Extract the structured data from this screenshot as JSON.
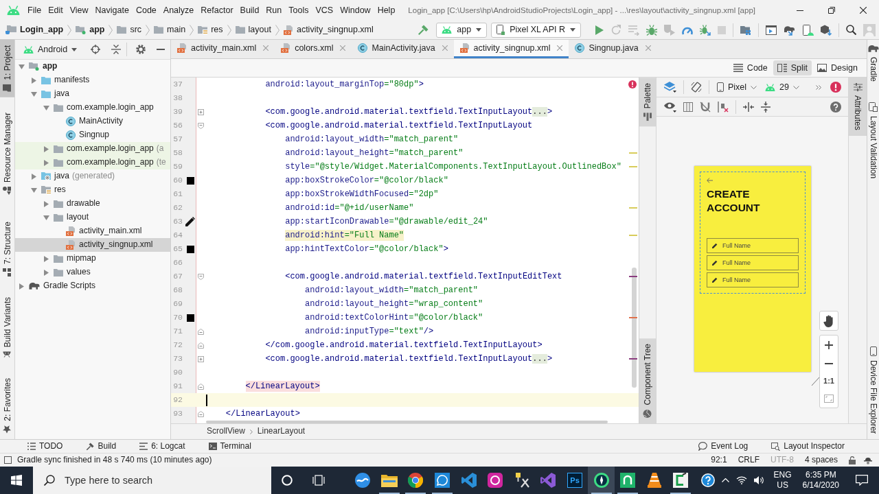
{
  "window": {
    "title": "Login_app [C:\\Users\\hp\\AndroidStudioProjects\\Login_app] - ...\\res\\layout\\activity_singnup.xml [app]"
  },
  "menu": [
    "File",
    "Edit",
    "View",
    "Navigate",
    "Code",
    "Analyze",
    "Refactor",
    "Build",
    "Run",
    "Tools",
    "VCS",
    "Window",
    "Help"
  ],
  "breadcrumbs": [
    {
      "label": "Login_app",
      "kind": "project"
    },
    {
      "label": "app",
      "kind": "module"
    },
    {
      "label": "src",
      "kind": "folder"
    },
    {
      "label": "main",
      "kind": "folder"
    },
    {
      "label": "res",
      "kind": "res"
    },
    {
      "label": "layout",
      "kind": "folder"
    },
    {
      "label": "activity_singnup.xml",
      "kind": "xml"
    }
  ],
  "toolbar": {
    "run_configuration": "app",
    "device": "Pixel XL API R",
    "action_groups": [
      [
        {
          "kind": "build",
          "disabled": false
        }
      ],
      [
        {
          "kind": "run",
          "disabled": false
        },
        {
          "kind": "apply-restart",
          "disabled": true
        },
        {
          "kind": "apply-code",
          "disabled": true
        },
        {
          "kind": "debug",
          "disabled": false
        },
        {
          "kind": "coverage",
          "disabled": true
        },
        {
          "kind": "profile",
          "disabled": false
        },
        {
          "kind": "attach",
          "disabled": false
        },
        {
          "kind": "stop",
          "disabled": true
        }
      ],
      [
        {
          "kind": "structure",
          "disabled": false
        }
      ],
      [
        {
          "kind": "window",
          "disabled": false
        },
        {
          "kind": "sync",
          "disabled": false
        },
        {
          "kind": "avd",
          "disabled": false
        },
        {
          "kind": "sdk",
          "disabled": false
        }
      ],
      [
        {
          "kind": "search",
          "disabled": false
        },
        {
          "kind": "account",
          "disabled": false
        }
      ]
    ]
  },
  "left_tool_strip": {
    "top": [
      {
        "label": "1: Project",
        "kind": "project",
        "selected": true
      },
      {
        "label": "Resource Manager",
        "kind": "resources",
        "selected": false
      }
    ],
    "bottom": [
      {
        "label": "7: Structure",
        "kind": "structure",
        "selected": false
      },
      {
        "label": "Build Variants",
        "kind": "variants",
        "selected": false
      },
      {
        "label": "2: Favorites",
        "kind": "favorites",
        "selected": false
      }
    ]
  },
  "project_view": {
    "mode": "Android",
    "tree": [
      {
        "label": "app",
        "kind": "module",
        "expanded": true,
        "selected": false,
        "children": [
          {
            "label": "manifests",
            "kind": "source",
            "expanded": false,
            "selected": false
          },
          {
            "label": "java",
            "kind": "source",
            "expanded": true,
            "selected": false,
            "children": [
              {
                "label": "com.example.login_app",
                "kind": "folder",
                "expanded": true,
                "selected": false,
                "children": [
                  {
                    "label": "MainActivity",
                    "kind": "class",
                    "selected": false
                  },
                  {
                    "label": "Singnup",
                    "kind": "class",
                    "selected": false
                  }
                ]
              },
              {
                "label": "com.example.login_app",
                "note": "(a",
                "kind": "test-package",
                "expanded": false,
                "selected": false
              },
              {
                "label": "com.example.login_app",
                "note": "(te",
                "kind": "test-package",
                "expanded": false,
                "selected": false
              }
            ]
          },
          {
            "label": "java",
            "note": "(generated)",
            "kind": "generated",
            "expanded": false,
            "selected": false
          },
          {
            "label": "res",
            "kind": "res",
            "expanded": true,
            "selected": false,
            "children": [
              {
                "label": "drawable",
                "kind": "folder",
                "expanded": false,
                "selected": false
              },
              {
                "label": "layout",
                "kind": "folder",
                "expanded": true,
                "selected": false,
                "children": [
                  {
                    "label": "activity_main.xml",
                    "kind": "xml",
                    "selected": false
                  },
                  {
                    "label": "activity_singnup.xml",
                    "kind": "xml",
                    "selected": true
                  }
                ]
              },
              {
                "label": "mipmap",
                "kind": "folder",
                "expanded": false,
                "selected": false
              },
              {
                "label": "values",
                "kind": "folder",
                "expanded": false,
                "selected": false
              }
            ]
          }
        ]
      },
      {
        "label": "Gradle Scripts",
        "kind": "gradle",
        "expanded": false,
        "selected": false
      }
    ]
  },
  "editor_tabs": [
    {
      "label": "activity_main.xml",
      "kind": "xml",
      "selected": false
    },
    {
      "label": "colors.xml",
      "kind": "xml",
      "selected": false
    },
    {
      "label": "MainActivity.java",
      "kind": "class",
      "selected": false
    },
    {
      "label": "activity_singnup.xml",
      "kind": "xml",
      "selected": true
    },
    {
      "label": "Singnup.java",
      "kind": "class",
      "selected": false
    }
  ],
  "view_modes": [
    {
      "label": "Code",
      "selected": false
    },
    {
      "label": "Split",
      "selected": true
    },
    {
      "label": "Design",
      "selected": false
    }
  ],
  "code": {
    "lines": [
      {
        "n": "37",
        "text": "            android:layout_marginTop=\"80dp\">"
      },
      {
        "n": "38"
      },
      {
        "n": "39",
        "text": "            <com.google.android.material.textfield.TextInputLayout",
        "fold": {
          "kind": "collapsed"
        },
        "folded": "...",
        "tail": ">"
      },
      {
        "n": "56",
        "text": "            <com.google.android.material.textfield.TextInputLayout",
        "fold": {
          "kind": "start"
        }
      },
      {
        "n": "57",
        "text": "                android:layout_width=\"match_parent\""
      },
      {
        "n": "58",
        "text": "                android:layout_height=\"match_parent\"",
        "stripe": {
          "kind": "warning"
        }
      },
      {
        "n": "59",
        "text": "                style=\"@style/Widget.MaterialComponents.TextInputLayout.OutlinedBox\"",
        "stripe": {
          "kind": "warning"
        }
      },
      {
        "n": "60",
        "text": "                app:boxStrokeColor=\"@color/black\"",
        "gutter": {
          "kind": "swatch",
          "color": "#000000"
        }
      },
      {
        "n": "61",
        "text": "                app:boxStrokeWidthFocused=\"2dp\""
      },
      {
        "n": "62",
        "text": "                android:id=\"@+id/userName\"",
        "stripe": {
          "kind": "warning"
        }
      },
      {
        "n": "63",
        "text": "                app:startIconDrawable=\"@drawable/edit_24\"",
        "gutter": {
          "kind": "drawable"
        }
      },
      {
        "n": "64",
        "text": "                android:hint=\"Full Name\"",
        "highlight": {
          "kind": "text"
        },
        "stripe": {
          "kind": "warning"
        }
      },
      {
        "n": "65",
        "text": "                app:hintTextColor=\"@color/black\">",
        "gutter": {
          "kind": "swatch",
          "color": "#000000"
        }
      },
      {
        "n": "66"
      },
      {
        "n": "67",
        "text": "                <com.google.android.material.textfield.TextInputEditText",
        "fold": {
          "kind": "start"
        },
        "stripe": {
          "kind": "info"
        }
      },
      {
        "n": "68",
        "text": "                    android:layout_width=\"match_parent\""
      },
      {
        "n": "69",
        "text": "                    android:layout_height=\"wrap_content\""
      },
      {
        "n": "70",
        "text": "                    android:textColorHint=\"@color/black\"",
        "gutter": {
          "kind": "swatch",
          "color": "#000000"
        },
        "stripe": {
          "kind": "error"
        }
      },
      {
        "n": "71",
        "text": "                    android:inputType=\"text\"/>",
        "fold": {
          "kind": "end"
        }
      },
      {
        "n": "72",
        "text": "            </com.google.android.material.textfield.TextInputLayout>",
        "fold": {
          "kind": "end"
        }
      },
      {
        "n": "73",
        "text": "            <com.google.android.material.textfield.TextInputLayout",
        "fold": {
          "kind": "collapsed"
        },
        "folded": "...",
        "tail": ">",
        "stripe": {
          "kind": "info"
        }
      },
      {
        "n": "90"
      },
      {
        "n": "91",
        "text": "        </LinearLayout>",
        "fold": {
          "kind": "end"
        },
        "highlight": {
          "kind": "tag"
        }
      },
      {
        "n": "92",
        "highlight": {
          "kind": "caret"
        }
      },
      {
        "n": "93",
        "text": "    </LinearLayout>",
        "fold": {
          "kind": "end"
        }
      }
    ]
  },
  "editor_breadcrumbs": [
    "ScrollView",
    "LinearLayout"
  ],
  "design": {
    "left_tabs": {
      "top": [
        {
          "label": "Palette",
          "kind": "palette"
        }
      ],
      "bottom": [
        {
          "label": "Component Tree",
          "kind": "tree"
        }
      ]
    },
    "right_tabs": [
      {
        "label": "Attributes",
        "kind": "attributes"
      }
    ],
    "device": "Pixel",
    "api_level": "29",
    "zoom_label": "1:1",
    "preview": {
      "title": "CREATE ACCOUNT",
      "fields": [
        {
          "placeholder": "Full Name"
        },
        {
          "placeholder": "Full Name"
        },
        {
          "placeholder": "Full Name"
        }
      ]
    }
  },
  "right_tool_strip": {
    "top": [
      {
        "label": "Gradle",
        "kind": "gradle"
      },
      {
        "label": "Layout Validation",
        "kind": "validation"
      }
    ],
    "bottom": [
      {
        "label": "Device File Explorer",
        "kind": "device"
      }
    ]
  },
  "bottom_tool_windows": {
    "left": [
      {
        "label": "TODO",
        "kind": "todo"
      },
      {
        "label": "Build",
        "kind": "build"
      },
      {
        "label": "6: Logcat",
        "kind": "logcat"
      },
      {
        "label": "Terminal",
        "kind": "terminal"
      }
    ],
    "right": [
      {
        "label": "Event Log",
        "kind": "events"
      },
      {
        "label": "Layout Inspector",
        "kind": "inspector"
      }
    ]
  },
  "status_bar": {
    "message": "Gradle sync finished in 48 s 740 ms (10 minutes ago)",
    "widgets": [
      {
        "label": "92:1",
        "disabled": false
      },
      {
        "label": "CRLF",
        "disabled": false
      },
      {
        "label": "UTF-8",
        "disabled": true
      },
      {
        "label": "4 spaces",
        "disabled": false
      }
    ]
  },
  "taskbar": {
    "search_placeholder": "Type here to search",
    "apps": [
      {
        "kind": "swirl",
        "selected": false,
        "running": false
      },
      {
        "kind": "folder",
        "selected": false,
        "running": true
      },
      {
        "kind": "segmented",
        "selected": false,
        "running": true
      },
      {
        "kind": "chat",
        "selected": false,
        "running": true
      },
      {
        "kind": "ribbon",
        "selected": false,
        "running": false
      },
      {
        "kind": "tile",
        "selected": false,
        "running": false
      },
      {
        "kind": "tools",
        "selected": false,
        "running": false
      },
      {
        "kind": "loop",
        "selected": false,
        "running": false
      },
      {
        "kind": "letters",
        "label": "Ps",
        "selected": false,
        "running": false
      },
      {
        "kind": "compass",
        "selected": true,
        "running": true
      },
      {
        "kind": "square",
        "selected": false,
        "running": true
      },
      {
        "kind": "cone",
        "selected": false,
        "running": false
      },
      {
        "kind": "bracket",
        "selected": false,
        "running": true
      }
    ],
    "language": "ENG",
    "region": "US",
    "time": "6:35 PM",
    "date": "6/14/2020"
  }
}
